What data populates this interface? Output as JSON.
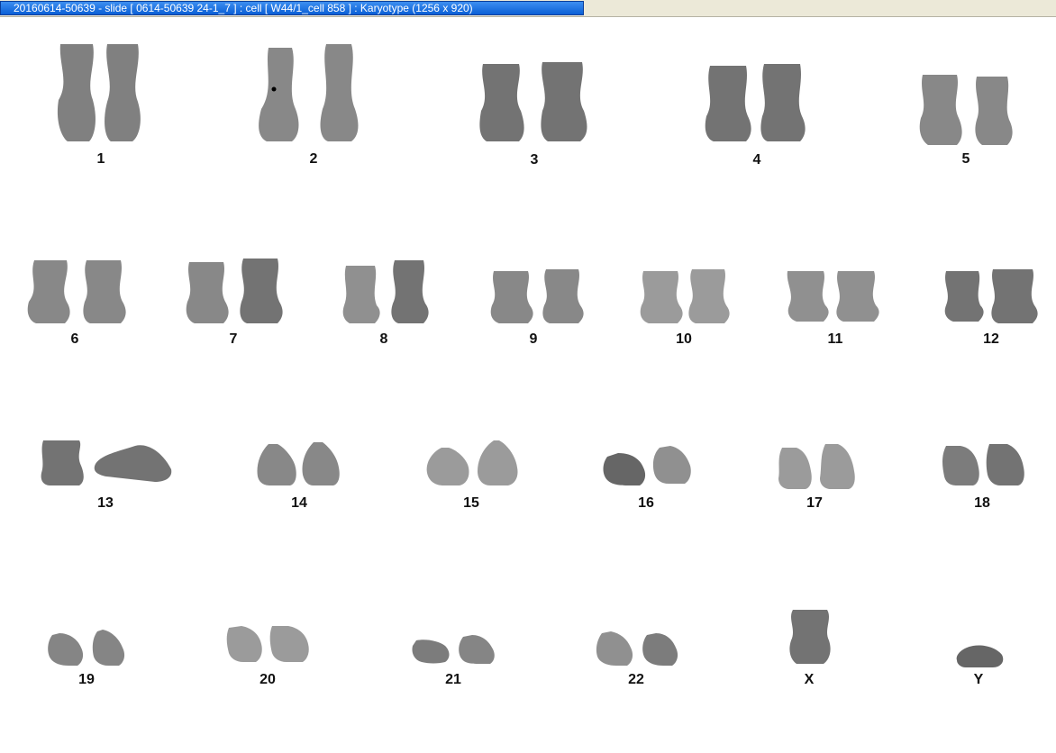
{
  "window": {
    "title": "20160614-50639 - slide [ 0614-50639 24-1_7 ] : cell [ W44/1_cell 858 ] : Karyotype  (1256 x 920)"
  },
  "chromosomes": [
    {
      "label": "1",
      "type": "large"
    },
    {
      "label": "2",
      "type": "large"
    },
    {
      "label": "3",
      "type": "large"
    },
    {
      "label": "4",
      "type": "large"
    },
    {
      "label": "5",
      "type": "large"
    },
    {
      "label": "6",
      "type": "medium"
    },
    {
      "label": "7",
      "type": "medium"
    },
    {
      "label": "8",
      "type": "medium"
    },
    {
      "label": "9",
      "type": "medium"
    },
    {
      "label": "10",
      "type": "medium"
    },
    {
      "label": "11",
      "type": "medium"
    },
    {
      "label": "12",
      "type": "medium"
    },
    {
      "label": "13",
      "type": "acro"
    },
    {
      "label": "14",
      "type": "acro"
    },
    {
      "label": "15",
      "type": "acro"
    },
    {
      "label": "16",
      "type": "small"
    },
    {
      "label": "17",
      "type": "small"
    },
    {
      "label": "18",
      "type": "small"
    },
    {
      "label": "19",
      "type": "tiny"
    },
    {
      "label": "20",
      "type": "tiny"
    },
    {
      "label": "21",
      "type": "tiny"
    },
    {
      "label": "22",
      "type": "tiny"
    },
    {
      "label": "X",
      "type": "single"
    },
    {
      "label": "Y",
      "type": "single-small"
    }
  ]
}
